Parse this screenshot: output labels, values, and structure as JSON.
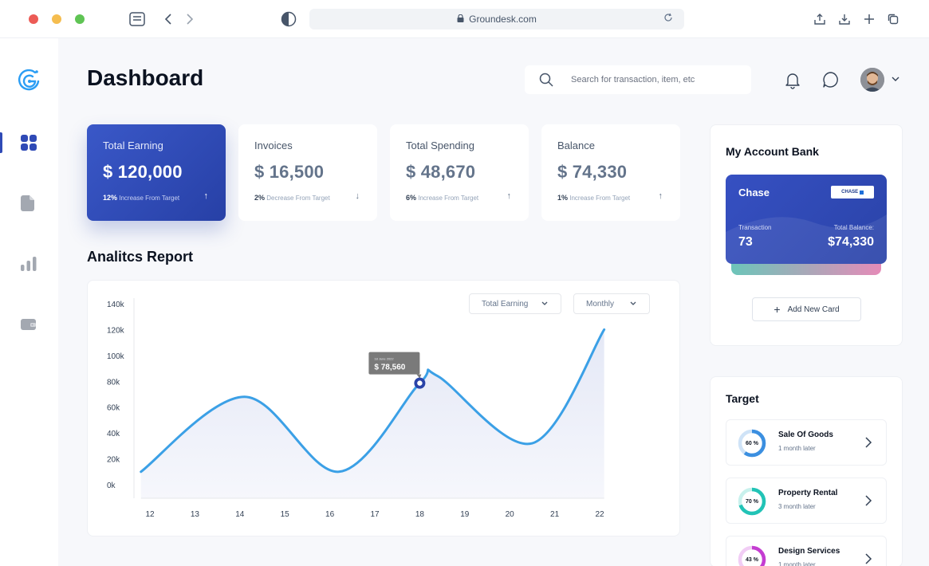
{
  "browser": {
    "url": "Groundesk.com",
    "traffic_lights": [
      "#ec5b56",
      "#f5bd4f",
      "#5fc454"
    ]
  },
  "sidebar": {
    "items": [
      {
        "icon": "logo-icon"
      },
      {
        "icon": "dashboard-grid-icon",
        "active": true
      },
      {
        "icon": "document-icon"
      },
      {
        "icon": "bar-chart-icon"
      },
      {
        "icon": "wallet-icon"
      }
    ],
    "accent": "#2f4ab6"
  },
  "header": {
    "title": "Dashboard",
    "search_placeholder": "Search for transaction, item, etc"
  },
  "stats": [
    {
      "label": "Total Earning",
      "value": "$ 120,000",
      "pct": "12%",
      "note": "Increase From Target",
      "arrow": "↑"
    },
    {
      "label": "Invoices",
      "value": "$ 16,500",
      "pct": "2%",
      "note": "Decrease From Target",
      "arrow": "↓"
    },
    {
      "label": "Total Spending",
      "value": "$ 48,670",
      "pct": "6%",
      "note": "Increase From Target",
      "arrow": "↑"
    },
    {
      "label": "Balance",
      "value": "$ 74,330",
      "pct": "1%",
      "note": "Increase From Target",
      "arrow": "↑"
    }
  ],
  "report": {
    "title": "Analitcs Report",
    "filter_metric": "Total Earning",
    "filter_period": "Monthly"
  },
  "chart_data": {
    "type": "area",
    "x": [
      12,
      13,
      14,
      15,
      16,
      17,
      18,
      19,
      20,
      21,
      22
    ],
    "y_ticks": [
      "140k",
      "120k",
      "100k",
      "80k",
      "60k",
      "40k",
      "20k",
      "0k"
    ],
    "ylim": [
      0,
      140000
    ],
    "curve": [
      {
        "x": 11.8,
        "y": 10000
      },
      {
        "x": 14.1,
        "y": 68000
      },
      {
        "x": 16.2,
        "y": 10000
      },
      {
        "x": 18.0,
        "y": 78560
      },
      {
        "x": 18.4,
        "y": 84000
      },
      {
        "x": 20.5,
        "y": 32000
      },
      {
        "x": 22.1,
        "y": 120000
      }
    ],
    "highlight": {
      "x": 18,
      "y": 78560,
      "date": "18 June 2022",
      "label": "$ 78,560"
    },
    "line_color": "#3ba0e6",
    "marker_color": "#2a43a8",
    "grid": false
  },
  "bank": {
    "title": "My Account Bank",
    "card_name": "Chase",
    "card_logo": "CHASE",
    "transaction_label": "Transaction",
    "transaction_value": "73",
    "balance_label": "Total Balance:",
    "balance_value": "$74,330",
    "add_label": "Add New Card"
  },
  "target": {
    "title": "Target",
    "items": [
      {
        "pct": "60 %",
        "value": 0.6,
        "name": "Sale Of Goods",
        "time": "1 month later",
        "color": "#3b8fe0",
        "track": "#cfe3f7"
      },
      {
        "pct": "70 %",
        "value": 0.7,
        "name": "Property Rental",
        "time": "3 month later",
        "color": "#22c3b6",
        "track": "#c8f1ed"
      },
      {
        "pct": "43 %",
        "value": 0.43,
        "name": "Design Services",
        "time": "1 month later",
        "color": "#c43dd1",
        "track": "#f1cdf5"
      }
    ]
  }
}
